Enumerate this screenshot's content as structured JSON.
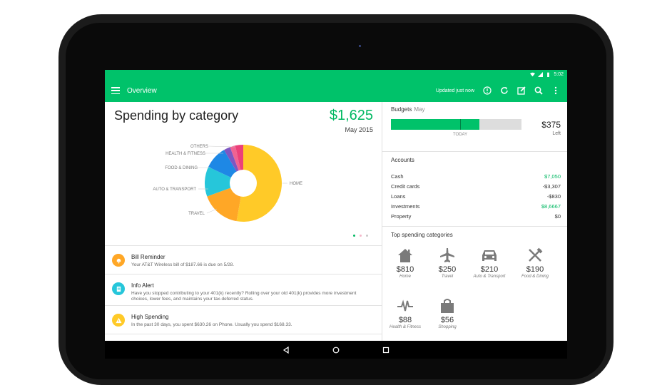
{
  "status_bar": {
    "time": "5:02"
  },
  "toolbar": {
    "title": "Overview",
    "updated": "Updated just now",
    "icons": [
      "menu-icon",
      "info-icon",
      "refresh-icon",
      "edit-icon",
      "search-icon",
      "more-icon"
    ]
  },
  "spending": {
    "title": "Spending by category",
    "amount": "$1,625",
    "period": "May 2015",
    "slice_labels": [
      "OTHERS",
      "HEALTH & FITNESS",
      "FOOD & DINING",
      "AUTO & TRANSPORT",
      "TRAVEL",
      "HOME"
    ],
    "colors": {
      "home": "#ffca28",
      "travel": "#ffa726",
      "auto": "#26c6da",
      "food": "#1e88e5",
      "health": "#7e57c2",
      "others": "#ec407a",
      "others2": "#f06292"
    }
  },
  "alerts": [
    {
      "title": "Bill Reminder",
      "body": "Your AT&T Wireless bill of $187.66 is due on 5/28.",
      "color": "#ffa726",
      "icon": "bell-icon"
    },
    {
      "title": "Info Alert",
      "body": "Have you stopped contributing to your 401(k) recently? Rolling over your old 401(k) provides more investment choices, lower fees, and maintains your tax-deferred status.",
      "color": "#26c6da",
      "icon": "info-doc-icon"
    },
    {
      "title": "High Spending",
      "body": "In the past 30 days, you spent $630.26 on Phone.  Usually you spend $168.33.",
      "color": "#ffca28",
      "icon": "warning-icon"
    }
  ],
  "budgets": {
    "title": "Budgets",
    "month": "May",
    "today_label": "TODAY",
    "left_amount": "$375",
    "left_label": "Left",
    "spent_fraction": 0.68,
    "today_fraction": 0.53
  },
  "accounts": {
    "title": "Accounts",
    "rows": [
      {
        "label": "Cash",
        "value": "$7,050",
        "positive": true
      },
      {
        "label": "Credit cards",
        "value": "-$3,307",
        "positive": false
      },
      {
        "label": "Loans",
        "value": "-$830",
        "positive": false
      },
      {
        "label": "Investments",
        "value": "$8,6667",
        "positive": true
      },
      {
        "label": "Property",
        "value": "$0",
        "positive": false
      }
    ]
  },
  "top_categories": {
    "title": "Top spending categories",
    "items": [
      {
        "amount": "$810",
        "name": "Home",
        "icon": "home-icon"
      },
      {
        "amount": "$250",
        "name": "Travel",
        "icon": "airplane-icon"
      },
      {
        "amount": "$210",
        "name": "Auto & Transport",
        "icon": "car-icon"
      },
      {
        "amount": "$190",
        "name": "Food & Dining",
        "icon": "fork-knife-icon"
      },
      {
        "amount": "$88",
        "name": "Health & Fitness",
        "icon": "pulse-icon"
      },
      {
        "amount": "$56",
        "name": "Shopping",
        "icon": "shopping-bag-icon"
      }
    ]
  }
}
